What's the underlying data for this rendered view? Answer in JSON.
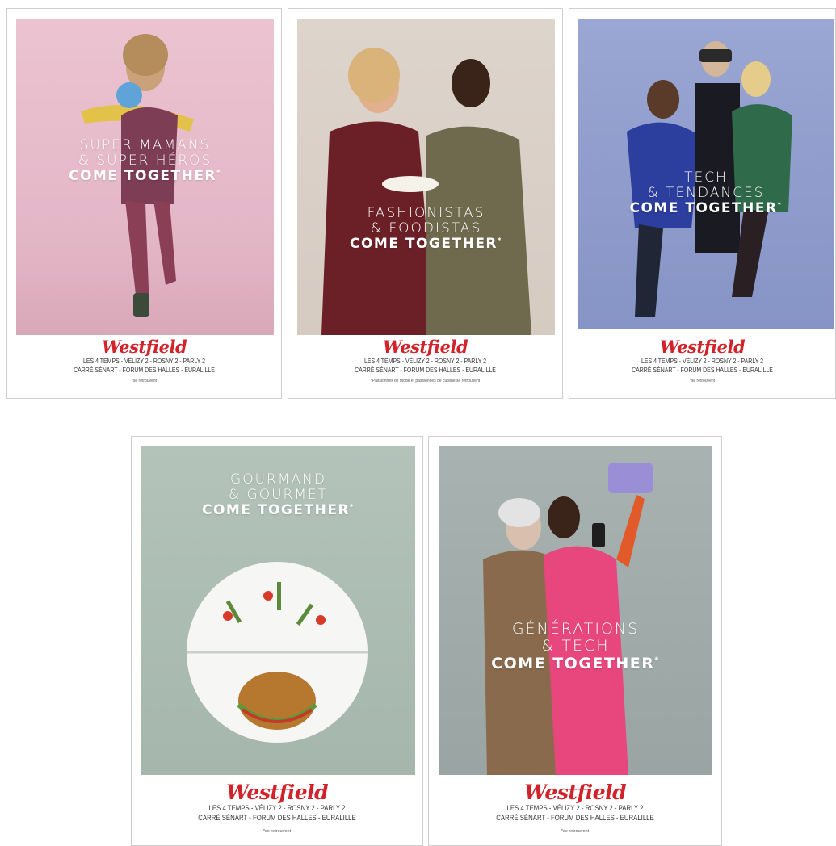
{
  "brand": "Westfield",
  "malls_line1": "LES 4 TEMPS - VÉLIZY 2 - ROSNY 2 - PARLY 2",
  "malls_line2": "CARRÉ SÉNART - FORUM DES HALLES - EURALILLE",
  "posters": [
    {
      "headline": [
        "SUPER MAMANS",
        "& SUPER HÉROS",
        "COME TOGETHER"
      ],
      "note": "*se retrouvent",
      "bg": "#e7bccb"
    },
    {
      "headline": [
        "FASHIONISTAS",
        "& FOODISTAS",
        "COME TOGETHER"
      ],
      "note": "*Passionnés de mode et passionnés de cuisine se retrouvent",
      "bg": "#d9d0c8"
    },
    {
      "headline": [
        "TECH",
        "& TENDANCES",
        "COME TOGETHER"
      ],
      "note": "*se retrouvent",
      "bg": "#8e9bcb"
    },
    {
      "headline": [
        "GOURMAND",
        "& GOURMET",
        "COME TOGETHER"
      ],
      "note": "*se retrouvent",
      "bg": "#a9bab1"
    },
    {
      "headline": [
        "GÉNÉRATIONS",
        "& TECH",
        "COME TOGETHER"
      ],
      "note": "*se retrouvent",
      "bg": "#a2adab"
    }
  ],
  "asterisk": "*"
}
